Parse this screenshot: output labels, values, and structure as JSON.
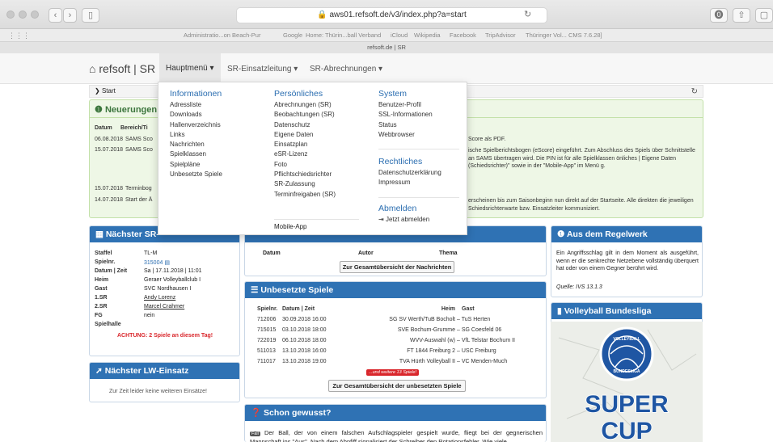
{
  "browser": {
    "url": "aws01.refsoft.de/v3/index.php?a=start",
    "tab_title": "refsoft.de | SR",
    "favorites": [
      "Administratio...on Beach-Pur",
      "Google",
      "Home: Thürin...ball Verband",
      "iCloud",
      "Wikipedia",
      "Facebook",
      "TripAdvisor",
      "Thüringer Vol... CMS 7.6.28]"
    ]
  },
  "nav": {
    "brand": "refsoft | SR",
    "menu": [
      "Hauptmenü ▾",
      "SR-Einsatzleitung ▾",
      "SR-Abrechnungen ▾"
    ]
  },
  "breadcrumb": "Start",
  "news": {
    "title": "Neuerungen I",
    "head_date": "Datum",
    "head_area": "Bereich/Ti",
    "rows": [
      {
        "date": "06.08.2018",
        "area": "SAMS Sco",
        "text": "Score als PDF."
      },
      {
        "date": "15.07.2018",
        "area": "SAMS Sco",
        "text": "ische Spielberichtsbogen (eScore) eingeführt. Zum Abschluss des Spiels über Schnittstelle an SAMS übertragen wird. Die PIN ist für alle Spielklassen önliches | Eigene Daten (Schiedsrichter)\" sowie in der \"Mobile-App\" im Menü g."
      },
      {
        "date": "15.07.2018",
        "area": "Terminbog",
        "text": ""
      },
      {
        "date": "14.07.2018",
        "area": "Start der Ä",
        "text": "erscheinen bis zum Saisonbeginn nun direkt auf der Startseite. Alle direkten die jeweiligen Schiedsrichterwarte bzw. Einsatzleiter kommuniziert."
      }
    ]
  },
  "dropdown": {
    "informationen": {
      "title": "Informationen",
      "items": [
        "Adressliste",
        "Downloads",
        "Hallenverzeichnis",
        "Links",
        "Nachrichten",
        "Spielklassen",
        "Spielpläne",
        "Unbesetzte Spiele"
      ]
    },
    "persoenliches": {
      "title": "Persönliches",
      "items": [
        "Abrechnungen (SR)",
        "Beobachtungen (SR)",
        "Datenschutz",
        "Eigene Daten",
        "Einsatzplan",
        "eSR-Lizenz",
        "Foto",
        "Pflichtschiedsrichter",
        "SR-Zulassung",
        "Terminfreigaben (SR)"
      ],
      "mobile": "Mobile-App"
    },
    "system": {
      "title": "System",
      "items": [
        "Benutzer-Profil",
        "SSL-Informationen",
        "Status",
        "Webbrowser"
      ]
    },
    "rechtliches": {
      "title": "Rechtliches",
      "items": [
        "Datenschutzerklärung",
        "Impressum"
      ]
    },
    "abmelden": {
      "title": "Abmelden",
      "logout": "Jetzt abmelden"
    }
  },
  "next_sr": {
    "title": "Nächster SR-",
    "fields": [
      [
        "Staffel",
        "TL-M"
      ],
      [
        "Spielnr.",
        "315004"
      ],
      [
        "Datum | Zeit",
        "Sa | 17.11.2018 | 11:01"
      ],
      [
        "Heim",
        "Geraer Volleyballclub I"
      ],
      [
        "Gast",
        "SVC Nordhausen I"
      ],
      [
        "1.SR",
        "Andy Lorenz"
      ],
      [
        "2.SR",
        "Marcel Crahmer"
      ],
      [
        "FG",
        "nein"
      ],
      [
        "Spielhalle",
        ""
      ]
    ],
    "warning": "ACHTUNG: 2 Spiele an diesem Tag!"
  },
  "next_lw": {
    "title": "Nächster LW-Einsatz",
    "text": "Zur Zeit leider keine weiteren Einsätze!"
  },
  "messages": {
    "cols": [
      "Datum",
      "Autor",
      "Thema"
    ],
    "button": "Zur Gesamtübersicht der Nachrichten"
  },
  "unbesetzt": {
    "title": "Unbesetzte Spiele",
    "head": [
      "Spielnr.",
      "Datum | Zeit",
      "Heim",
      "Gast"
    ],
    "rows": [
      [
        "712006",
        "30.09.2018 16:00",
        "SG SV Werth/TuB Bocholt",
        "TuS Herten"
      ],
      [
        "715015",
        "03.10.2018 18:00",
        "SVE Bochum-Grumme",
        "SG Coesfeld 06"
      ],
      [
        "722019",
        "06.10.2018 18:00",
        "WVV-Auswahl (w)",
        "VfL Telstar Bochum II"
      ],
      [
        "511013",
        "13.10.2018 16:00",
        "FT 1844 Freiburg 2",
        "USC Freiburg"
      ],
      [
        "711017",
        "13.10.2018 19:00",
        "TVA Hürth Volleyball II",
        "VC Menden-Much"
      ]
    ],
    "more": "...und weitere 13 Spiele!",
    "button": "Zur Gesamtübersicht der unbesetzten Spiele"
  },
  "schon": {
    "title": "Schon gewusst?",
    "badge": "Fall",
    "text": "Der Ball, der von einem falschen Aufschlagspieler gespielt wurde, fliegt bei der gegnerischen Mannschaft ins \"Aus\". Nach dem Abpfiff signalisiert der Schreiber den Rotationsfehler. Wie viele"
  },
  "regelwerk": {
    "title": "Aus dem Regelwerk",
    "text": "Ein Angriffsschlag gilt in dem Moment als ausgeführt, wenn er die senkrechte Netzebene vollständig überquert hat oder von einem Gegner berührt wird.",
    "source": "Quelle: IVS 13.1.3"
  },
  "bundesliga": {
    "title": "Volleyball Bundesliga",
    "logo1": "VOLLEYBALL",
    "logo2": "BUNDESLIGA",
    "super": "SUPER",
    "cup": "CUP"
  },
  "colors": {
    "primary": "#2f72b4",
    "success_bg": "#eef7e6",
    "warning": "#d9262b"
  }
}
